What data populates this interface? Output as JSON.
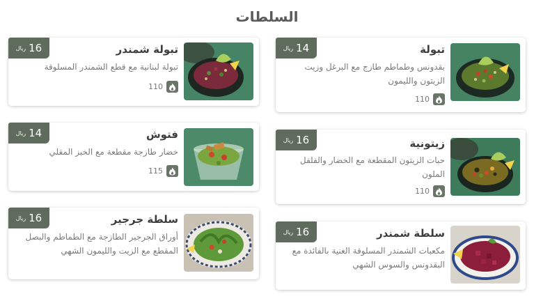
{
  "section_title": "السلطات",
  "currency": "ريال",
  "items": [
    {
      "name": "تبولة",
      "description": "بقدونس وطماطم طازج مع البرغل وزيت الزيتون والليمون",
      "price": "14",
      "calories": "110"
    },
    {
      "name": "تبولة شمندر",
      "description": "تبولة لبنانية مع قطع الشمندر المسلوقة",
      "price": "16",
      "calories": "110"
    },
    {
      "name": "زيتونية",
      "description": "حبات الزيتون المقطعة مع الخضار والفلفل الملون",
      "price": "16",
      "calories": "110"
    },
    {
      "name": "فتوش",
      "description": "خضار طازجة مقطعة مع الخبز المقلي",
      "price": "14",
      "calories": "115"
    },
    {
      "name": "سلطة شمندر",
      "description": "مكعبات الشمندر المسلوقة الغنية بالفائدة مع البقدونس والسوس الشهي",
      "price": "16"
    },
    {
      "name": "سلطة جرجير",
      "description": "أوراق الجرجير الطازجة مع الطماطم والبصل المقطع مع الزيت والليمون الشهي",
      "price": "16"
    }
  ],
  "icons": {
    "calorie": "flame-icon"
  },
  "colors": {
    "accent": "#5f6b5c",
    "badge": "#6a7468"
  }
}
